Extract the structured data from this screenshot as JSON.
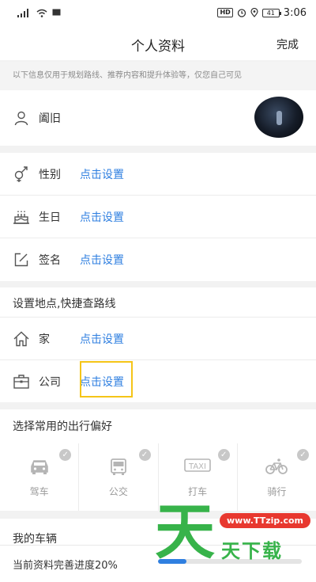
{
  "status_bar": {
    "signal": "ᵃᴵ|",
    "wifi": "WiFi",
    "hd": "HD",
    "battery": "41",
    "time": "3:06"
  },
  "header": {
    "title": "个人资料",
    "done_label": "完成"
  },
  "notice": "以下信息仅用于规划路线、推荐内容和提升体验等，仅您自己可见",
  "profile": {
    "name": "阖旧"
  },
  "basic": {
    "gender_label": "性别",
    "gender_value": "点击设置",
    "birthday_label": "生日",
    "birthday_value": "点击设置",
    "signature_label": "签名",
    "signature_value": "点击设置"
  },
  "places": {
    "title": "设置地点,快捷查路线",
    "home_label": "家",
    "home_value": "点击设置",
    "company_label": "公司",
    "company_value": "点击设置"
  },
  "travel": {
    "title": "选择常用的出行偏好",
    "modes": [
      {
        "label": "驾车",
        "icon": "car-icon"
      },
      {
        "label": "公交",
        "icon": "bus-icon"
      },
      {
        "label": "打车",
        "icon": "taxi-icon"
      },
      {
        "label": "骑行",
        "icon": "bike-icon"
      }
    ]
  },
  "vehicle": {
    "title": "我的车辆"
  },
  "progress": {
    "label": "当前资料完善进度20%",
    "value": 0.2
  },
  "watermark": {
    "url": "www.TTzip.com",
    "glyph": "天",
    "text": "天下载"
  },
  "colors": {
    "link": "#2f7fe0",
    "watermark_green": "#37b34a",
    "watermark_red": "#e8382f",
    "highlight": "#f5c518"
  }
}
